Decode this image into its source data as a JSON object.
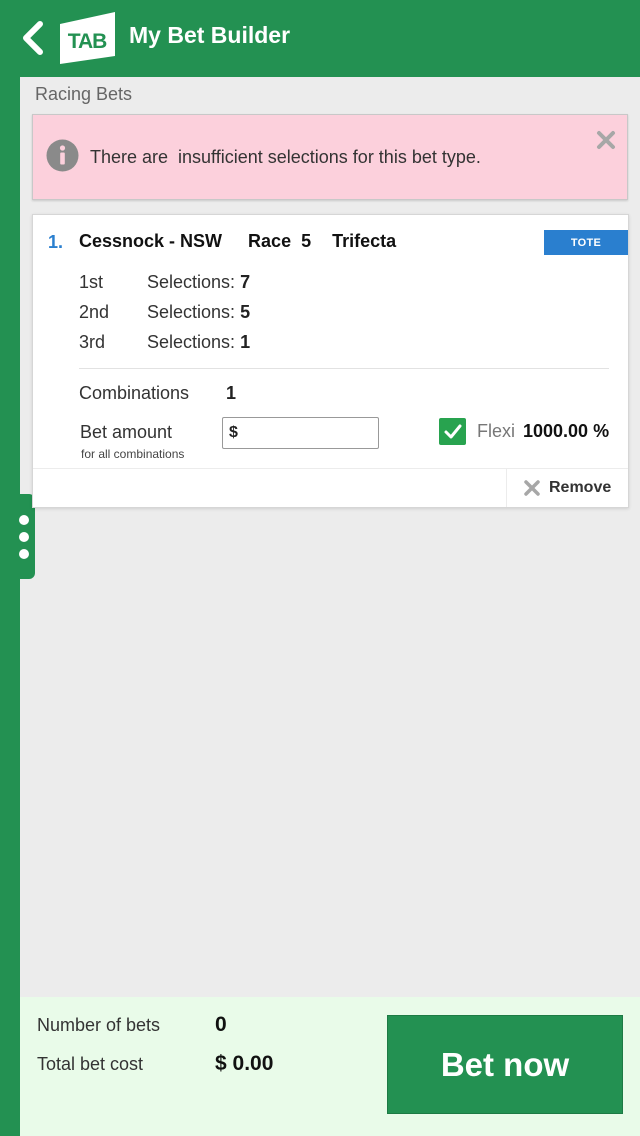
{
  "header": {
    "title": "My Bet Builder",
    "logo_text": "TAB",
    "brand_color": "#239152"
  },
  "section": {
    "label": "Racing Bets"
  },
  "alert": {
    "message": "There are  insufficient selections for this bet type.",
    "bg_color": "#fcd0dc"
  },
  "bet": {
    "number": "1.",
    "venue": "Cessnock - NSW",
    "race_label": "Race",
    "race_number": "5",
    "bet_type": "Trifecta",
    "badge": "TOTE",
    "selections": [
      {
        "position": "1st",
        "label": "Selections: ",
        "count": "7"
      },
      {
        "position": "2nd",
        "label": "Selections: ",
        "count": "5"
      },
      {
        "position": "3rd",
        "label": "Selections: ",
        "count": "1"
      }
    ],
    "combinations_label": "Combinations",
    "combinations_value": "1",
    "amount_label": "Bet amount",
    "amount_sub": "for all combinations",
    "amount_prefix": "$",
    "flexi_label": "Flexi",
    "flexi_value": "1000.00 %",
    "flexi_checked": true,
    "remove_label": "Remove"
  },
  "footer": {
    "num_bets_label": "Number of bets",
    "num_bets_value": "0",
    "total_label": "Total bet cost",
    "total_value": "$ 0.00",
    "bet_now_label": "Bet now"
  },
  "icons": {
    "back": "chevron-left-icon",
    "info": "info-icon",
    "close": "close-icon",
    "check": "check-icon",
    "more": "more-vertical-icon"
  }
}
